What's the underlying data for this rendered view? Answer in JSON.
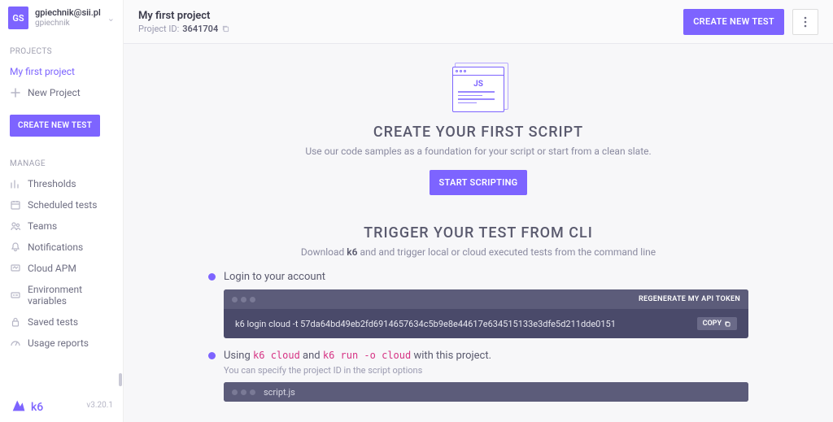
{
  "user": {
    "avatar": "GS",
    "email": "gpiechnik@sii.pl",
    "name": "gpiechnik"
  },
  "sidebar": {
    "projects_label": "PROJECTS",
    "active_project": "My first project",
    "new_project": "New Project",
    "create_test_btn": "CREATE NEW TEST",
    "manage_label": "MANAGE",
    "items": [
      "Thresholds",
      "Scheduled tests",
      "Teams",
      "Notifications",
      "Cloud APM",
      "Environment variables",
      "Saved tests",
      "Usage reports"
    ],
    "logo_text": "k6",
    "version": "v3.20.1"
  },
  "header": {
    "title": "My first project",
    "project_id_label": "Project ID:",
    "project_id": "3641704",
    "create_test_btn": "CREATE NEW TEST"
  },
  "empty": {
    "js_badge": "JS",
    "title": "CREATE YOUR FIRST SCRIPT",
    "subtitle": "Use our code samples as a foundation for your script or start from a clean slate.",
    "start_btn": "START SCRIPTING"
  },
  "cli": {
    "title": "TRIGGER YOUR TEST FROM CLI",
    "subtitle_pre": "Download ",
    "subtitle_link": "k6",
    "subtitle_post": " and and trigger local or cloud executed tests from the command line",
    "step1_title": "Login to your account",
    "step1_cmd": "k6 login cloud -t 57da64bd49eb2fd6914657634c5b9e8e44617e634515133e3dfe5d211dde0151",
    "regen_label": "REGENERATE MY API TOKEN",
    "copy_label": "COPY",
    "step2_pre": "Using ",
    "step2_code1": "k6 cloud",
    "step2_mid": " and ",
    "step2_code2": "k6 run -o cloud",
    "step2_post": " with this project.",
    "step2_desc": "You can specify the project ID in the script options",
    "script_file": "script.js"
  }
}
